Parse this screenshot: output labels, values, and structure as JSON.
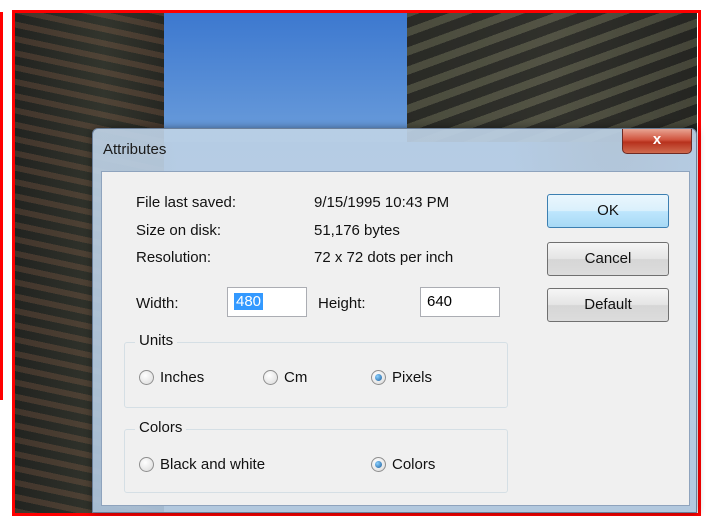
{
  "dialog": {
    "title": "Attributes",
    "close_label": "x"
  },
  "info": {
    "file_last_saved_label": "File last saved:",
    "file_last_saved_value": "9/15/1995 10:43 PM",
    "size_on_disk_label": "Size on disk:",
    "size_on_disk_value": "51,176 bytes",
    "resolution_label": "Resolution:",
    "resolution_value": "72 x 72 dots per inch"
  },
  "dimensions": {
    "width_label": "Width:",
    "width_value": "480",
    "height_label": "Height:",
    "height_value": "640"
  },
  "units": {
    "title": "Units",
    "options": [
      "Inches",
      "Cm",
      "Pixels"
    ],
    "selected": "Pixels"
  },
  "colors": {
    "title": "Colors",
    "options": [
      "Black and white",
      "Colors"
    ],
    "selected": "Colors"
  },
  "buttons": {
    "ok": "OK",
    "cancel": "Cancel",
    "default": "Default"
  },
  "theme": {
    "highlight_border": "#ff0000",
    "selection": "#3399ff"
  }
}
